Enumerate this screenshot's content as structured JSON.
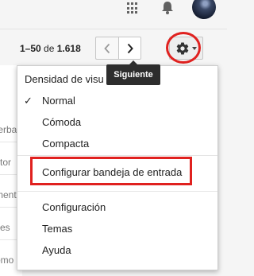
{
  "header": {
    "apps_icon": "apps-grid-icon",
    "notifications_icon": "bell-icon",
    "avatar_icon": "account-avatar"
  },
  "toolbar": {
    "page_range": "1–50",
    "page_of": "de",
    "page_total": "1.618",
    "prev_icon": "chevron-left-icon",
    "next_icon": "chevron-right-icon",
    "settings_icon": "gear-icon"
  },
  "tooltip": {
    "label": "Siguiente"
  },
  "background_rows": [
    "terba",
    "ctor",
    "ment",
    "ves",
    "omo"
  ],
  "settings_menu": {
    "density_header": "Densidad de visu",
    "density_options": [
      {
        "label": "Normal",
        "checked": true
      },
      {
        "label": "Cómoda",
        "checked": false
      },
      {
        "label": "Compacta",
        "checked": false
      }
    ],
    "configure_inbox": "Configurar bandeja de entrada",
    "items": [
      "Configuración",
      "Temas",
      "Ayuda"
    ],
    "check_glyph": "✓"
  },
  "annotation_color": "#e0211f"
}
